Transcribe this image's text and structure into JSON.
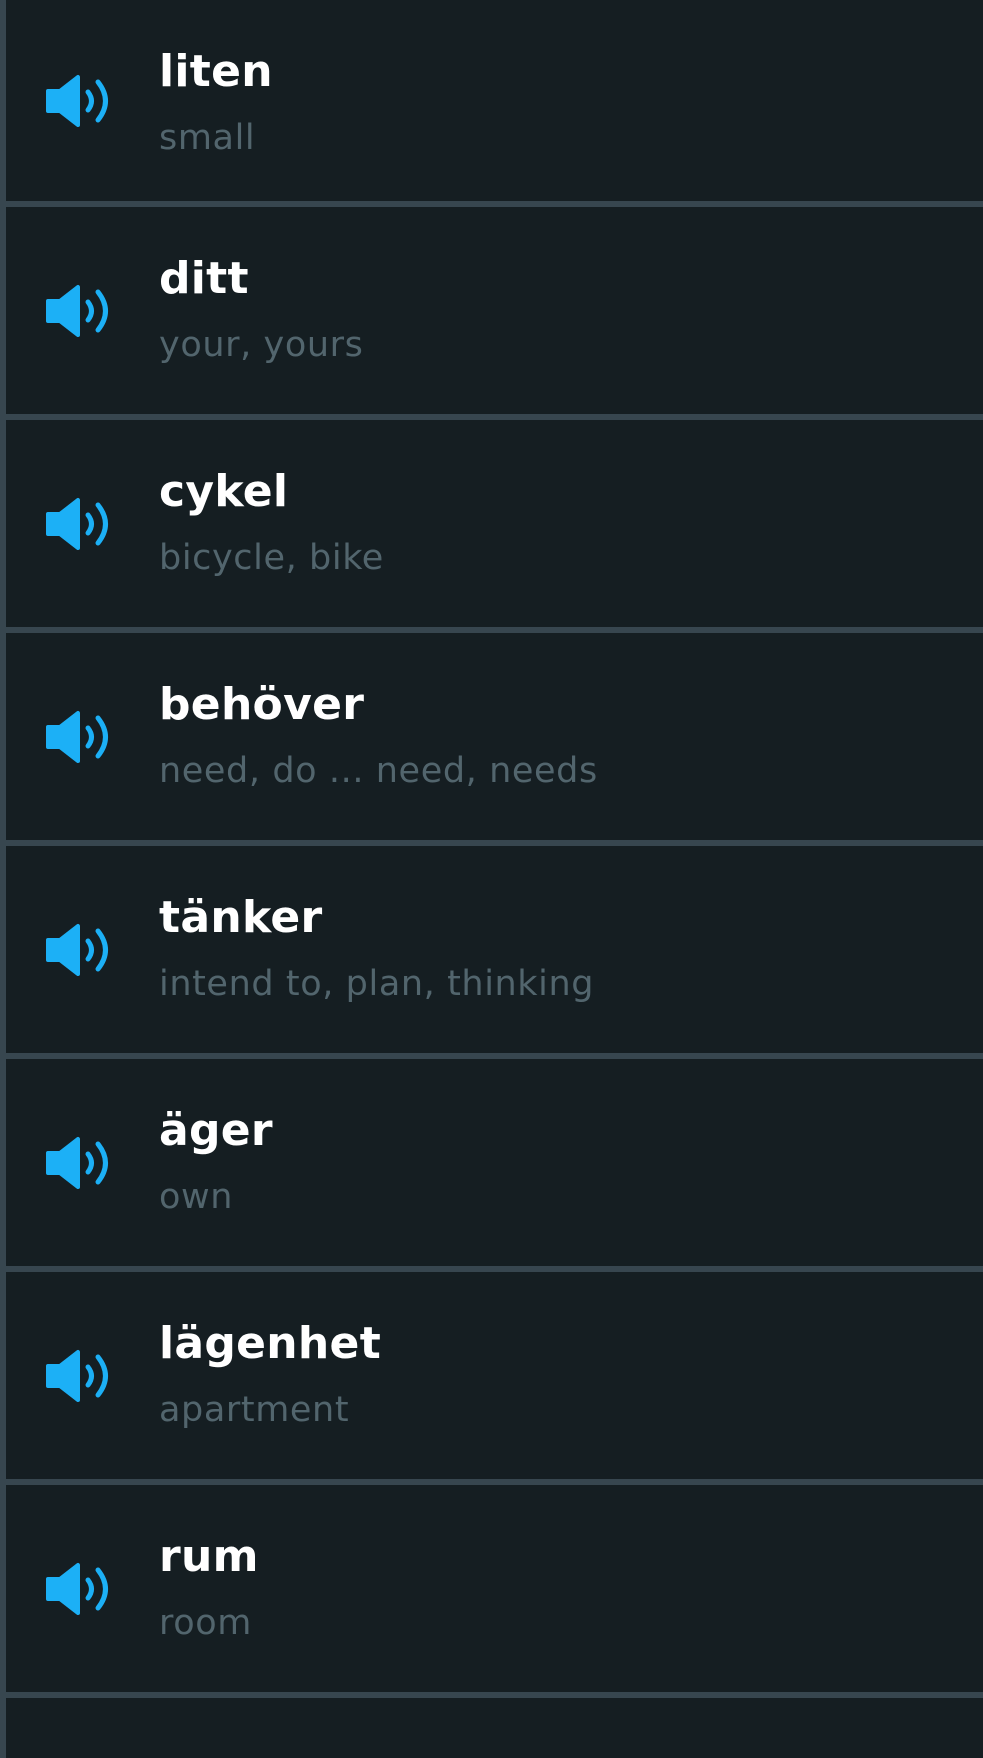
{
  "colors": {
    "background": "#151e22",
    "divider": "#37464f",
    "word": "#ffffff",
    "translation": "#52656d",
    "speaker": "#1cb0f6"
  },
  "words": [
    {
      "word": "liten",
      "translation": "small",
      "icon": "speaker-icon"
    },
    {
      "word": "ditt",
      "translation": "your, yours",
      "icon": "speaker-icon"
    },
    {
      "word": "cykel",
      "translation": "bicycle, bike",
      "icon": "speaker-icon"
    },
    {
      "word": "behöver",
      "translation": "need, do ... need, needs",
      "icon": "speaker-icon"
    },
    {
      "word": "tänker",
      "translation": "intend to, plan, thinking",
      "icon": "speaker-icon"
    },
    {
      "word": "äger",
      "translation": "own",
      "icon": "speaker-icon"
    },
    {
      "word": "lägenhet",
      "translation": "apartment",
      "icon": "speaker-icon"
    },
    {
      "word": "rum",
      "translation": "room",
      "icon": "speaker-icon"
    }
  ]
}
